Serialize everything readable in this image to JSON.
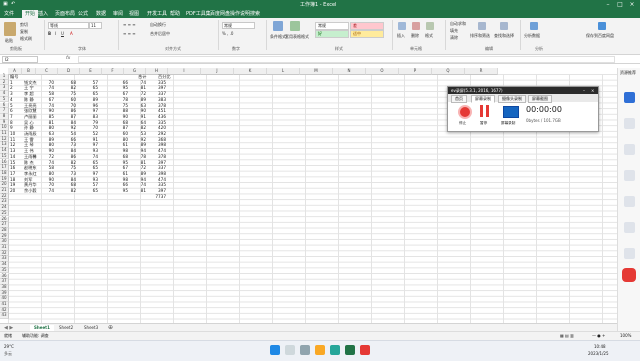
{
  "window": {
    "title": "工作簿1 - Excel"
  },
  "ribbon_tabs": [
    "文件",
    "开始",
    "插入",
    "页面布局",
    "公式",
    "数据",
    "审阅",
    "视图",
    "开发工具",
    "帮助",
    "PDF工具集",
    "百度网盘",
    "操作说明搜索"
  ],
  "ribbon": {
    "clipboard": {
      "paste": "粘贴",
      "cut": "剪切",
      "copy": "复制",
      "format_painter": "格式刷",
      "group": "剪贴板"
    },
    "font": {
      "name": "等线",
      "size": "11",
      "group": "字体"
    },
    "alignment": {
      "wrap": "自动换行",
      "merge": "合并后居中",
      "group": "对齐方式"
    },
    "number": {
      "format": "常规",
      "group": "数字"
    },
    "styles": {
      "cond_format": "条件格式",
      "table_format": "套用表格格式",
      "normal": "常规",
      "bad": "差",
      "good": "好",
      "neutral": "适中",
      "group": "样式"
    },
    "cells": {
      "insert": "插入",
      "delete": "删除",
      "format": "格式",
      "group": "单元格"
    },
    "editing": {
      "autosum": "自动求和",
      "fill": "填充",
      "clear": "清除",
      "sort": "排序和筛选",
      "find": "查找和选择",
      "group": "编辑"
    },
    "extras": {
      "analyze": "分析数据",
      "share": "保存到百度网盘",
      "group": "分析"
    }
  },
  "formula_bar": {
    "name_box": "I2",
    "fx": "fx",
    "value": ""
  },
  "columns": [
    "A",
    "B",
    "C",
    "D",
    "E",
    "F",
    "G",
    "H",
    "I",
    "J",
    "K",
    "L",
    "M",
    "N",
    "O",
    "P",
    "Q",
    "R"
  ],
  "header_row": {
    "a": "编号",
    "g": "合计",
    "h": "百分比"
  },
  "rows": [
    {
      "n": "1",
      "name": "钱文杰",
      "c": "70",
      "d": "68",
      "e": "57",
      "f": "66",
      "g": "74",
      "sum": "335"
    },
    {
      "n": "2",
      "name": "王 宁",
      "c": "74",
      "d": "82",
      "e": "65",
      "f": "95",
      "g": "81",
      "sum": "397"
    },
    {
      "n": "3",
      "name": "李 超",
      "c": "58",
      "d": "75",
      "e": "65",
      "f": "67",
      "g": "72",
      "sum": "337"
    },
    {
      "n": "4",
      "name": "陈 静",
      "c": "67",
      "d": "60",
      "e": "89",
      "f": "78",
      "g": "89",
      "sum": "383"
    },
    {
      "n": "5",
      "name": "王亮亮",
      "c": "74",
      "d": "70",
      "e": "96",
      "f": "75",
      "g": "63",
      "sum": "378"
    },
    {
      "n": "6",
      "name": "张欣慧",
      "c": "90",
      "d": "86",
      "e": "97",
      "f": "88",
      "g": "90",
      "sum": "451"
    },
    {
      "n": "7",
      "name": "卢丽丽",
      "c": "85",
      "d": "87",
      "e": "83",
      "f": "90",
      "g": "91",
      "sum": "436"
    },
    {
      "n": "8",
      "name": "吴 心",
      "c": "81",
      "d": "84",
      "e": "79",
      "f": "68",
      "g": "64",
      "sum": "335"
    },
    {
      "n": "9",
      "name": "孙 静",
      "c": "80",
      "d": "92",
      "e": "70",
      "f": "87",
      "g": "82",
      "sum": "420"
    },
    {
      "n": "10",
      "name": "汤雨辰",
      "c": "63",
      "d": "54",
      "e": "52",
      "f": "60",
      "g": "53",
      "sum": "292"
    },
    {
      "n": "11",
      "name": "王 雷",
      "c": "89",
      "d": "66",
      "e": "91",
      "f": "80",
      "g": "92",
      "sum": "368"
    },
    {
      "n": "12",
      "name": "王 琴",
      "c": "80",
      "d": "73",
      "e": "97",
      "f": "61",
      "g": "89",
      "sum": "398"
    },
    {
      "n": "13",
      "name": "王 伟",
      "c": "90",
      "d": "84",
      "e": "93",
      "f": "98",
      "g": "94",
      "sum": "474"
    },
    {
      "n": "14",
      "name": "王雨馨",
      "c": "72",
      "d": "86",
      "e": "74",
      "f": "68",
      "g": "78",
      "sum": "378"
    },
    {
      "n": "15",
      "name": "陈 杰",
      "c": "74",
      "d": "82",
      "e": "65",
      "f": "95",
      "g": "81",
      "sum": "397"
    },
    {
      "n": "16",
      "name": "赵晓东",
      "c": "58",
      "d": "75",
      "e": "65",
      "f": "67",
      "g": "72",
      "sum": "337"
    },
    {
      "n": "17",
      "name": "李永红",
      "c": "80",
      "d": "73",
      "e": "97",
      "f": "61",
      "g": "89",
      "sum": "398"
    },
    {
      "n": "18",
      "name": "刘军",
      "c": "90",
      "d": "84",
      "e": "93",
      "f": "98",
      "g": "94",
      "sum": "474"
    },
    {
      "n": "19",
      "name": "黄丹华",
      "c": "70",
      "d": "68",
      "e": "57",
      "f": "66",
      "g": "74",
      "sum": "335"
    },
    {
      "n": "20",
      "name": "余小毅",
      "c": "74",
      "d": "82",
      "e": "65",
      "f": "95",
      "g": "81",
      "sum": "397"
    }
  ],
  "total": "7737",
  "row_numbers": [
    "1",
    "2",
    "3",
    "4",
    "5",
    "6",
    "7",
    "8",
    "9",
    "10",
    "11",
    "12",
    "13",
    "14",
    "15",
    "16",
    "17",
    "18",
    "19",
    "20",
    "21",
    "22",
    "23",
    "24",
    "25",
    "26",
    "27",
    "28",
    "29",
    "30",
    "31",
    "32",
    "33",
    "34",
    "35",
    "36",
    "37",
    "38",
    "39",
    "40",
    "41",
    "42",
    "43"
  ],
  "sheet_tabs": [
    "Sheet1",
    "Sheet2",
    "Sheet3"
  ],
  "status": {
    "ready": "就绪",
    "accessibility": "辅助功能: 调查",
    "zoom": "100%"
  },
  "evcam": {
    "title": "ev录屏(5.3.1, 2016, 1677)",
    "tabs": [
      "首页",
      "屏幕录制",
      "摄像头录制",
      "屏幕截图"
    ],
    "stop": "停止",
    "pause": "暂停",
    "screen": "屏幕录制",
    "timer": "00:00:00",
    "size": "0bytes / 101.7GB"
  },
  "side_panel": {
    "title": "资源推荐"
  },
  "taskbar": {
    "weather_temp": "29°C",
    "weather": "多云",
    "time": "10:48",
    "date": "2023/1/25"
  },
  "colors": {
    "excel_green": "#217346",
    "evcam_red": "#e53935"
  }
}
